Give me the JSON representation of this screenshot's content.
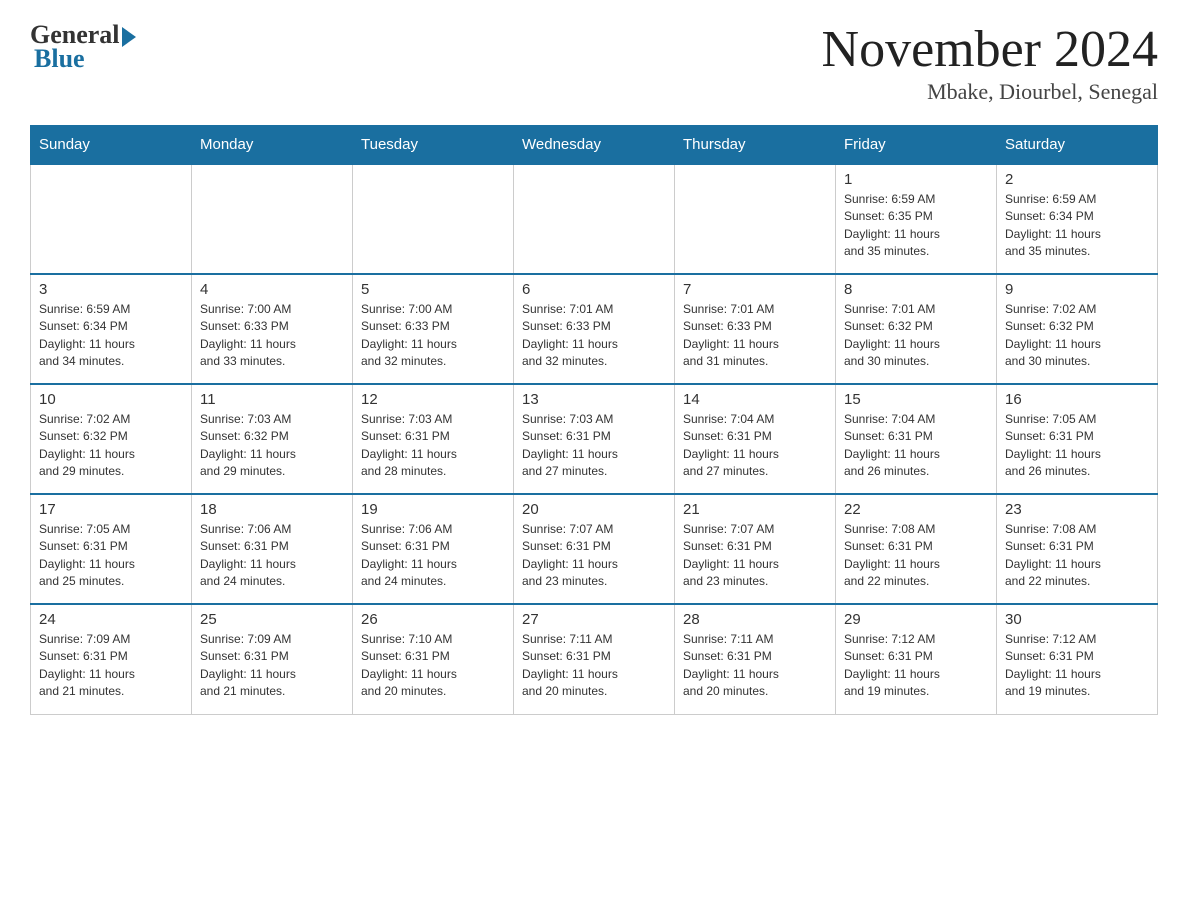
{
  "header": {
    "logo_general": "General",
    "logo_blue": "Blue",
    "month_title": "November 2024",
    "location": "Mbake, Diourbel, Senegal"
  },
  "weekdays": [
    "Sunday",
    "Monday",
    "Tuesday",
    "Wednesday",
    "Thursday",
    "Friday",
    "Saturday"
  ],
  "weeks": [
    [
      {
        "day": "",
        "info": ""
      },
      {
        "day": "",
        "info": ""
      },
      {
        "day": "",
        "info": ""
      },
      {
        "day": "",
        "info": ""
      },
      {
        "day": "",
        "info": ""
      },
      {
        "day": "1",
        "info": "Sunrise: 6:59 AM\nSunset: 6:35 PM\nDaylight: 11 hours\nand 35 minutes."
      },
      {
        "day": "2",
        "info": "Sunrise: 6:59 AM\nSunset: 6:34 PM\nDaylight: 11 hours\nand 35 minutes."
      }
    ],
    [
      {
        "day": "3",
        "info": "Sunrise: 6:59 AM\nSunset: 6:34 PM\nDaylight: 11 hours\nand 34 minutes."
      },
      {
        "day": "4",
        "info": "Sunrise: 7:00 AM\nSunset: 6:33 PM\nDaylight: 11 hours\nand 33 minutes."
      },
      {
        "day": "5",
        "info": "Sunrise: 7:00 AM\nSunset: 6:33 PM\nDaylight: 11 hours\nand 32 minutes."
      },
      {
        "day": "6",
        "info": "Sunrise: 7:01 AM\nSunset: 6:33 PM\nDaylight: 11 hours\nand 32 minutes."
      },
      {
        "day": "7",
        "info": "Sunrise: 7:01 AM\nSunset: 6:33 PM\nDaylight: 11 hours\nand 31 minutes."
      },
      {
        "day": "8",
        "info": "Sunrise: 7:01 AM\nSunset: 6:32 PM\nDaylight: 11 hours\nand 30 minutes."
      },
      {
        "day": "9",
        "info": "Sunrise: 7:02 AM\nSunset: 6:32 PM\nDaylight: 11 hours\nand 30 minutes."
      }
    ],
    [
      {
        "day": "10",
        "info": "Sunrise: 7:02 AM\nSunset: 6:32 PM\nDaylight: 11 hours\nand 29 minutes."
      },
      {
        "day": "11",
        "info": "Sunrise: 7:03 AM\nSunset: 6:32 PM\nDaylight: 11 hours\nand 29 minutes."
      },
      {
        "day": "12",
        "info": "Sunrise: 7:03 AM\nSunset: 6:31 PM\nDaylight: 11 hours\nand 28 minutes."
      },
      {
        "day": "13",
        "info": "Sunrise: 7:03 AM\nSunset: 6:31 PM\nDaylight: 11 hours\nand 27 minutes."
      },
      {
        "day": "14",
        "info": "Sunrise: 7:04 AM\nSunset: 6:31 PM\nDaylight: 11 hours\nand 27 minutes."
      },
      {
        "day": "15",
        "info": "Sunrise: 7:04 AM\nSunset: 6:31 PM\nDaylight: 11 hours\nand 26 minutes."
      },
      {
        "day": "16",
        "info": "Sunrise: 7:05 AM\nSunset: 6:31 PM\nDaylight: 11 hours\nand 26 minutes."
      }
    ],
    [
      {
        "day": "17",
        "info": "Sunrise: 7:05 AM\nSunset: 6:31 PM\nDaylight: 11 hours\nand 25 minutes."
      },
      {
        "day": "18",
        "info": "Sunrise: 7:06 AM\nSunset: 6:31 PM\nDaylight: 11 hours\nand 24 minutes."
      },
      {
        "day": "19",
        "info": "Sunrise: 7:06 AM\nSunset: 6:31 PM\nDaylight: 11 hours\nand 24 minutes."
      },
      {
        "day": "20",
        "info": "Sunrise: 7:07 AM\nSunset: 6:31 PM\nDaylight: 11 hours\nand 23 minutes."
      },
      {
        "day": "21",
        "info": "Sunrise: 7:07 AM\nSunset: 6:31 PM\nDaylight: 11 hours\nand 23 minutes."
      },
      {
        "day": "22",
        "info": "Sunrise: 7:08 AM\nSunset: 6:31 PM\nDaylight: 11 hours\nand 22 minutes."
      },
      {
        "day": "23",
        "info": "Sunrise: 7:08 AM\nSunset: 6:31 PM\nDaylight: 11 hours\nand 22 minutes."
      }
    ],
    [
      {
        "day": "24",
        "info": "Sunrise: 7:09 AM\nSunset: 6:31 PM\nDaylight: 11 hours\nand 21 minutes."
      },
      {
        "day": "25",
        "info": "Sunrise: 7:09 AM\nSunset: 6:31 PM\nDaylight: 11 hours\nand 21 minutes."
      },
      {
        "day": "26",
        "info": "Sunrise: 7:10 AM\nSunset: 6:31 PM\nDaylight: 11 hours\nand 20 minutes."
      },
      {
        "day": "27",
        "info": "Sunrise: 7:11 AM\nSunset: 6:31 PM\nDaylight: 11 hours\nand 20 minutes."
      },
      {
        "day": "28",
        "info": "Sunrise: 7:11 AM\nSunset: 6:31 PM\nDaylight: 11 hours\nand 20 minutes."
      },
      {
        "day": "29",
        "info": "Sunrise: 7:12 AM\nSunset: 6:31 PM\nDaylight: 11 hours\nand 19 minutes."
      },
      {
        "day": "30",
        "info": "Sunrise: 7:12 AM\nSunset: 6:31 PM\nDaylight: 11 hours\nand 19 minutes."
      }
    ]
  ]
}
